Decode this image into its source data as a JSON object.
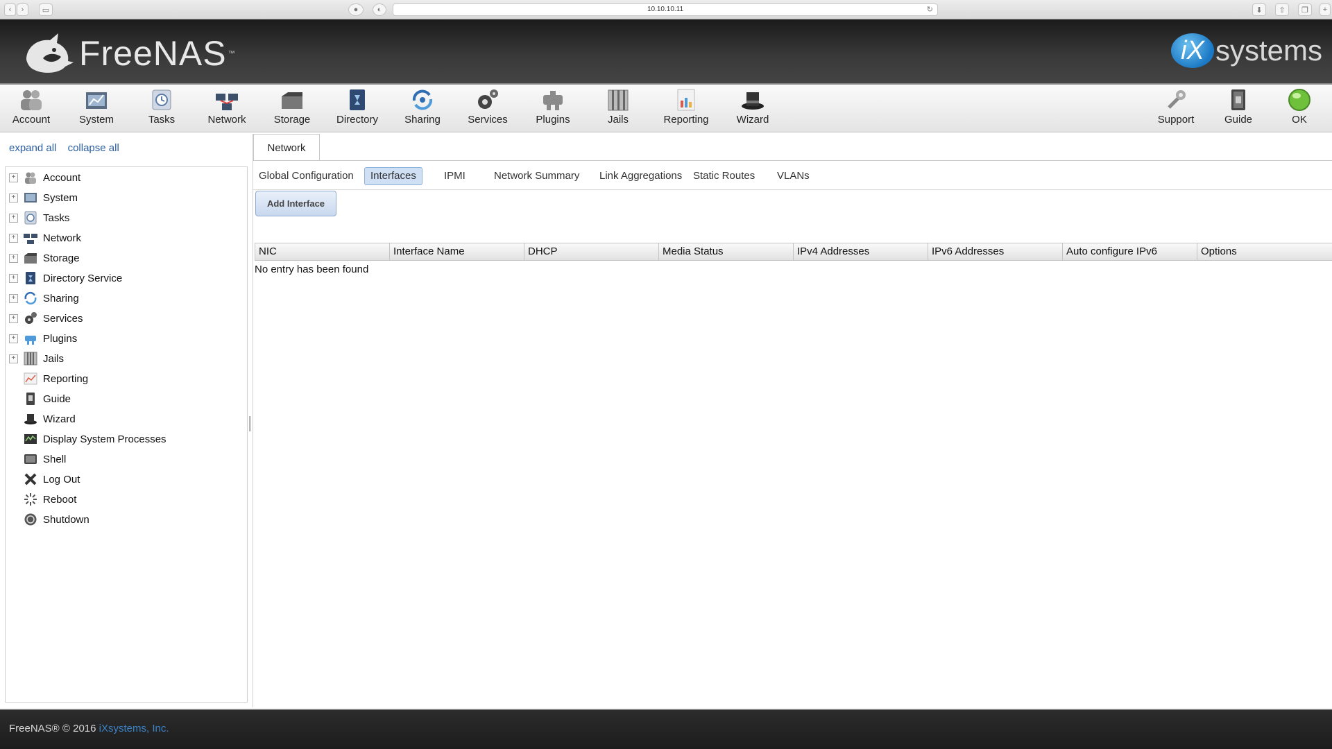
{
  "browser": {
    "url": "10.10.10.11"
  },
  "header": {
    "brand": "FreeNAS",
    "trademark": "™",
    "vendor_mark": "iX",
    "vendor_text": "systems"
  },
  "toolbar": {
    "left": [
      {
        "label": "Account",
        "icon": "account-icon"
      },
      {
        "label": "System",
        "icon": "system-icon"
      },
      {
        "label": "Tasks",
        "icon": "tasks-icon"
      },
      {
        "label": "Network",
        "icon": "network-icon"
      },
      {
        "label": "Storage",
        "icon": "storage-icon"
      },
      {
        "label": "Directory",
        "icon": "directory-icon"
      },
      {
        "label": "Sharing",
        "icon": "sharing-icon"
      },
      {
        "label": "Services",
        "icon": "services-icon"
      },
      {
        "label": "Plugins",
        "icon": "plugins-icon"
      },
      {
        "label": "Jails",
        "icon": "jails-icon"
      },
      {
        "label": "Reporting",
        "icon": "reporting-icon"
      },
      {
        "label": "Wizard",
        "icon": "wizard-icon"
      }
    ],
    "right": [
      {
        "label": "Support",
        "icon": "support-icon"
      },
      {
        "label": "Guide",
        "icon": "guide-icon"
      },
      {
        "label": "OK",
        "icon": "status-ok-icon"
      }
    ]
  },
  "sidebar": {
    "expand_all": "expand all",
    "collapse_all": "collapse all",
    "items": [
      {
        "label": "Account",
        "expandable": true
      },
      {
        "label": "System",
        "expandable": true
      },
      {
        "label": "Tasks",
        "expandable": true
      },
      {
        "label": "Network",
        "expandable": true
      },
      {
        "label": "Storage",
        "expandable": true
      },
      {
        "label": "Directory Service",
        "expandable": true
      },
      {
        "label": "Sharing",
        "expandable": true
      },
      {
        "label": "Services",
        "expandable": true
      },
      {
        "label": "Plugins",
        "expandable": true
      },
      {
        "label": "Jails",
        "expandable": true
      },
      {
        "label": "Reporting",
        "expandable": false
      },
      {
        "label": "Guide",
        "expandable": false
      },
      {
        "label": "Wizard",
        "expandable": false
      },
      {
        "label": "Display System Processes",
        "expandable": false
      },
      {
        "label": "Shell",
        "expandable": false
      },
      {
        "label": "Log Out",
        "expandable": false
      },
      {
        "label": "Reboot",
        "expandable": false
      },
      {
        "label": "Shutdown",
        "expandable": false
      }
    ]
  },
  "main": {
    "tab": "Network",
    "subtabs": [
      "Global Configuration",
      "Interfaces",
      "IPMI",
      "Network Summary",
      "Link Aggregations",
      "Static Routes",
      "VLANs"
    ],
    "active_subtab": "Interfaces",
    "add_button": "Add Interface",
    "columns": [
      "NIC",
      "Interface Name",
      "DHCP",
      "Media Status",
      "IPv4 Addresses",
      "IPv6 Addresses",
      "Auto configure IPv6",
      "Options"
    ],
    "empty_message": "No entry has been found"
  },
  "footer": {
    "copyright": "FreeNAS® © 2016",
    "company": "iXsystems, Inc."
  },
  "colors": {
    "link": "#2a5d9f",
    "active_tab": "#cfe0f5",
    "footer_link": "#3b82c6"
  }
}
